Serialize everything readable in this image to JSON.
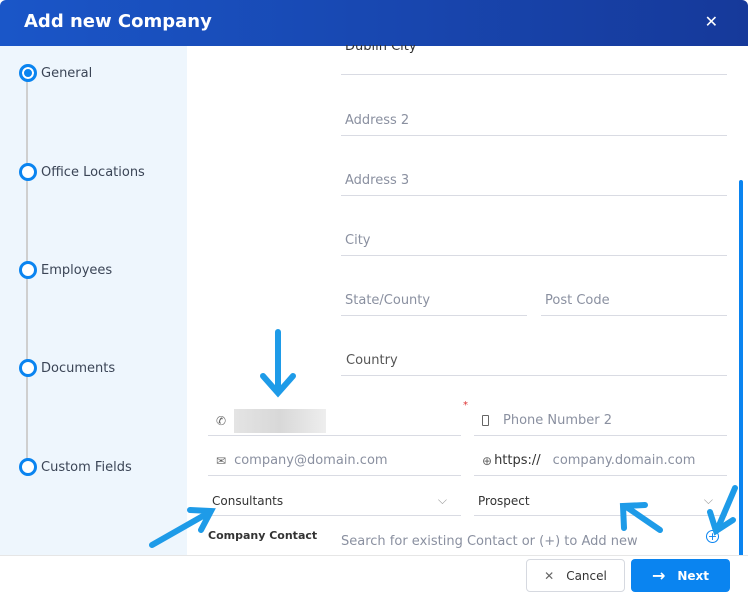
{
  "dialog": {
    "title": "Add new Company",
    "close_icon": "close-icon"
  },
  "steps": [
    {
      "label": "General",
      "active": true
    },
    {
      "label": "Office Locations"
    },
    {
      "label": "Employees"
    },
    {
      "label": "Documents"
    },
    {
      "label": "Custom Fields"
    }
  ],
  "form": {
    "address1_value": "Dublin City",
    "address2_placeholder": "Address 2",
    "address3_placeholder": "Address 3",
    "city_placeholder": "City",
    "state_placeholder": "State/County",
    "postcode_placeholder": "Post Code",
    "country_placeholder": "Country",
    "required_mark": "*",
    "phone2_placeholder": "Phone Number 2",
    "email_placeholder": "company@domain.com",
    "website_prefix": "https://",
    "website_placeholder": "company.domain.com",
    "consultants_value": "Consultants",
    "status_value": "Prospect",
    "company_contact_label": "Company Contact",
    "contact_search_placeholder": "Search for existing Contact or (+) to Add new"
  },
  "footer": {
    "cancel_label": "Cancel",
    "next_label": "Next"
  },
  "colors": {
    "accent": "#0a84f0",
    "header": "#1a56c8",
    "annotation": "#1e9be8"
  }
}
